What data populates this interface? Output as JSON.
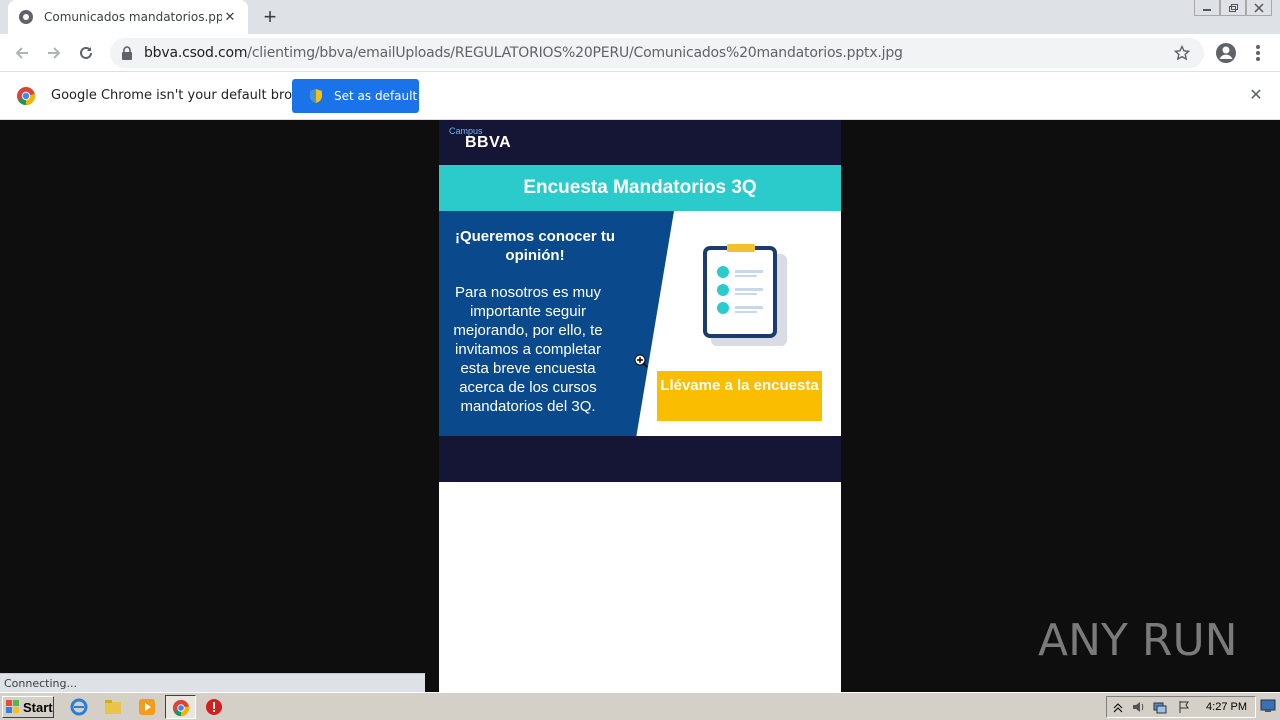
{
  "browser": {
    "tab": {
      "title": "Comunicados mandatorios.pptx.jpg",
      "close_label": "✕"
    },
    "new_tab_label": "+",
    "address": {
      "host": "bbva.csod.com",
      "path": "/clientimg/bbva/emailUploads/REGULATORIOS%20PERU/Comunicados%20mandatorios.pptx.jpg"
    },
    "infobar": {
      "message": "Google Chrome isn't your default browser",
      "button_label": "Set as default",
      "close_label": "✕"
    },
    "status_text": "Connecting..."
  },
  "email": {
    "brand_top": "Campus",
    "brand": "BBVA",
    "banner_title": "Encuesta Mandatorios 3Q",
    "headline": "¡Queremos conocer tu opinión!",
    "body": "Para nosotros es muy importante seguir mejorando, por ello, te invitamos a completar esta breve encuesta acerca de los cursos mandatorios del 3Q.",
    "cta_label": "Llévame a la encuesta"
  },
  "watermark": "ANY RUN",
  "taskbar": {
    "start_label": "Start",
    "clock": "4:27 PM"
  },
  "colors": {
    "navy": "#151536",
    "teal": "#2bcbcc",
    "blue": "#0a4a8c",
    "yellow": "#fbbd00",
    "chrome_blue": "#1a73e8"
  }
}
